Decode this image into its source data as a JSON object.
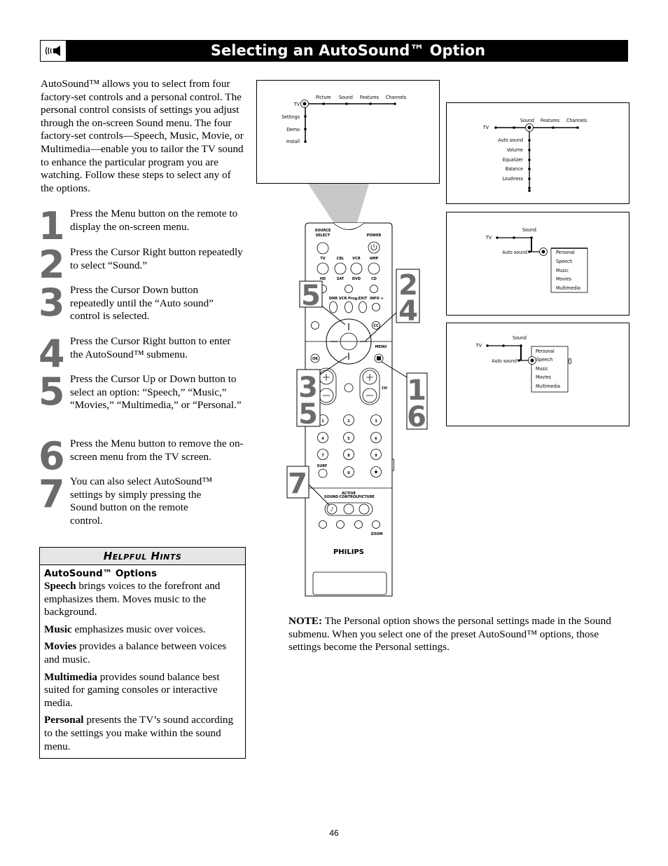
{
  "header": {
    "title": "Selecting an AutoSound™ Option",
    "icon": "speaker-sound-icon"
  },
  "intro": "AutoSound™ allows you to select from four factory-set controls and a personal control. The personal control consists of settings you adjust through the on-screen Sound menu. The four factory-set controls—Speech, Music, Movie, or Multimedia—enable you to tailor the TV sound to enhance the particular program you are watching. Follow these steps to select any of the options.",
  "steps": [
    {
      "num": "1",
      "text": "Press the Menu button on the remote to display the on-screen menu."
    },
    {
      "num": "2",
      "text": "Press the Cursor Right button repeatedly to select “Sound.”"
    },
    {
      "num": "3",
      "text": "Press the Cursor Down button repeatedly until the “Auto sound” control is selected."
    },
    {
      "num": "4",
      "text": "Press the Cursor Right button to enter the AutoSound™ submenu."
    },
    {
      "num": "5",
      "text": "Press the Cursor Up or Down button to select an option: “Speech,” “Music,” “Movies,” “Multimedia,” or “Personal.”"
    },
    {
      "num": "6",
      "text": "Press the Menu button to remove the on-screen menu from the TV screen."
    },
    {
      "num": "7",
      "text": "You can also select AutoSound™ settings by simply pressing the Sound button on the remote control."
    }
  ],
  "hints": {
    "title": "Helpful Hints",
    "subtitle": "AutoSound™ Options",
    "items": [
      {
        "term": "Speech",
        "text": " brings voices to the forefront and emphasizes them. Moves music to the background."
      },
      {
        "term": "Music",
        "text": " emphasizes music over voices."
      },
      {
        "term": "Movies",
        "text": " provides a balance between voices and music."
      },
      {
        "term": "Multimedia",
        "text": " provides sound balance best suited for gaming consoles or interactive media."
      },
      {
        "term": "Personal",
        "text": " presents the TV’s sound according to the settings you make within the sound menu."
      }
    ]
  },
  "screens": {
    "main": {
      "root": "TV",
      "top": [
        "Picture",
        "Sound",
        "Features",
        "Channels"
      ],
      "side": [
        "Settings",
        "Demo",
        "Install"
      ]
    },
    "sound": {
      "root": "TV",
      "top": [
        "Sound",
        "Features",
        "Channels"
      ],
      "side": [
        "Auto sound",
        "Volume",
        "Equalizer",
        "Balance",
        "Loudness"
      ]
    },
    "autosound": {
      "root": "TV",
      "top": "Sound",
      "item": "Auto sound",
      "options": [
        "Personal",
        "Speech",
        "Music",
        "Movies",
        "Multimedia"
      ]
    }
  },
  "remote": {
    "brand": "PHILIPS",
    "labels": {
      "source": "SOURCE",
      "select": "SELECT",
      "power": "POWER",
      "tv": "TV",
      "cbl": "CBL",
      "vcr": "VCR",
      "amp": "AMP",
      "hd": "HD",
      "sat": "SAT",
      "dvd": "DVD",
      "cd": "CD",
      "dnr": "DNR",
      "vcrprog": "VCR Prog.",
      "exit": "EXIT",
      "info": "INFO +",
      "cc": "CC",
      "menu": "MENU",
      "ok": "OK",
      "ch": "CH",
      "surf": "SURF",
      "active": "ACTIVE",
      "sound": "SOUND",
      "control": "CONTROL",
      "picture": "PICTURE",
      "zoom": "ZOOM"
    },
    "digits": [
      "1",
      "2",
      "3",
      "4",
      "5",
      "6",
      "7",
      "8",
      "9",
      "0"
    ],
    "callouts": {
      "a": "5",
      "b1": "2",
      "b2": "4",
      "c1": "3",
      "c2": "5",
      "d1": "1",
      "d2": "6",
      "e": "7"
    }
  },
  "note": {
    "label": "NOTE:",
    "text": " The Personal option shows the personal settings made in the Sound submenu. When you select one of the preset AutoSound™ options, those settings become the Personal settings."
  },
  "page_number": "46"
}
